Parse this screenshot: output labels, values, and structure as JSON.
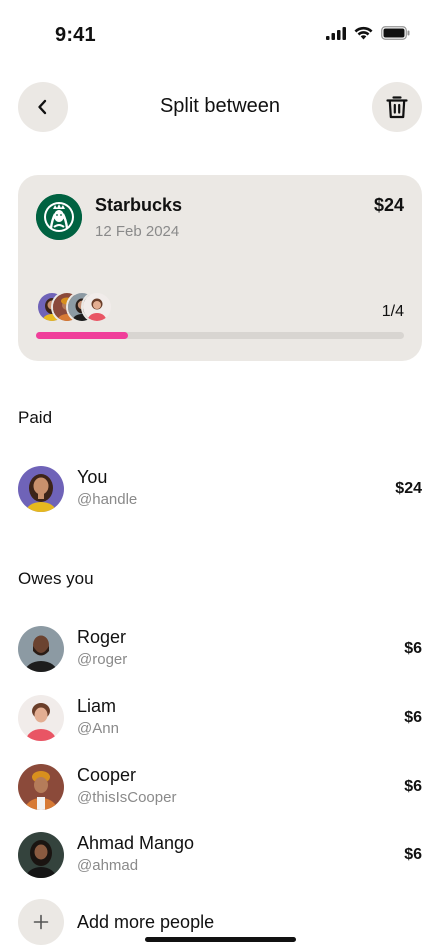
{
  "status_bar": {
    "time": "9:41"
  },
  "header": {
    "title": "Split between"
  },
  "expense": {
    "merchant": "Starbucks",
    "date": "12 Feb 2024",
    "amount": "$24",
    "progress_label": "1/4",
    "progress_fraction": 0.25,
    "progress_color": "#f03e9a"
  },
  "paid": {
    "heading": "Paid",
    "people": [
      {
        "name": "You",
        "handle": "@handle",
        "amount": "$24"
      }
    ]
  },
  "owes": {
    "heading": "Owes you",
    "people": [
      {
        "name": "Roger",
        "handle": "@roger",
        "amount": "$6"
      },
      {
        "name": "Liam",
        "handle": "@Ann",
        "amount": "$6"
      },
      {
        "name": "Cooper",
        "handle": "@thisIsCooper",
        "amount": "$6"
      },
      {
        "name": "Ahmad Mango",
        "handle": "@ahmad",
        "amount": "$6"
      }
    ]
  },
  "add_people": {
    "label": "Add more people"
  },
  "icons": {
    "back": "chevron-left-icon",
    "delete": "trash-icon",
    "add": "plus-icon"
  }
}
